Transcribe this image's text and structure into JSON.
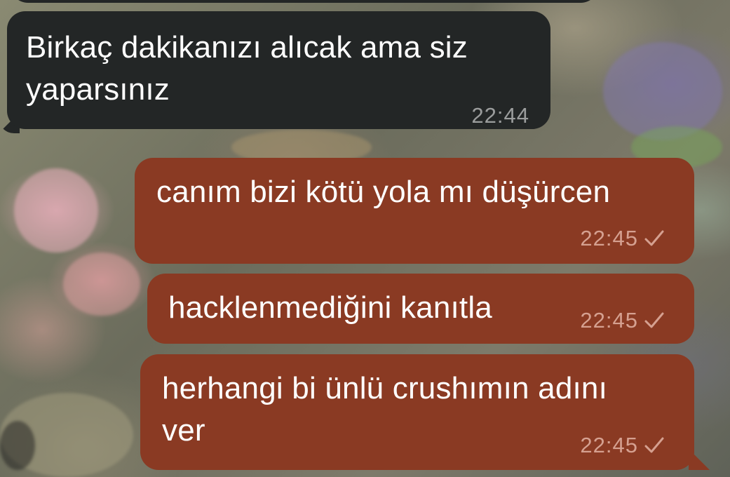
{
  "messages": [
    {
      "direction": "incoming",
      "text": "Birkaç dakikanızı alıcak ama siz\nyaparsınız",
      "time": "22:44"
    },
    {
      "direction": "outgoing",
      "text": "canım bizi kötü yola mı düşürcen",
      "time": "22:45",
      "status_icon": "check-icon"
    },
    {
      "direction": "outgoing",
      "text": "hacklenmediğini kanıtla",
      "time": "22:45",
      "status_icon": "check-icon"
    },
    {
      "direction": "outgoing",
      "text": "herhangi bi ünlü crushımın adını\nver",
      "time": "22:45",
      "status_icon": "check-icon"
    }
  ],
  "colors": {
    "incoming_bubble": "#232626",
    "outgoing_bubble": "#8a3a23",
    "text": "#ffffff"
  }
}
